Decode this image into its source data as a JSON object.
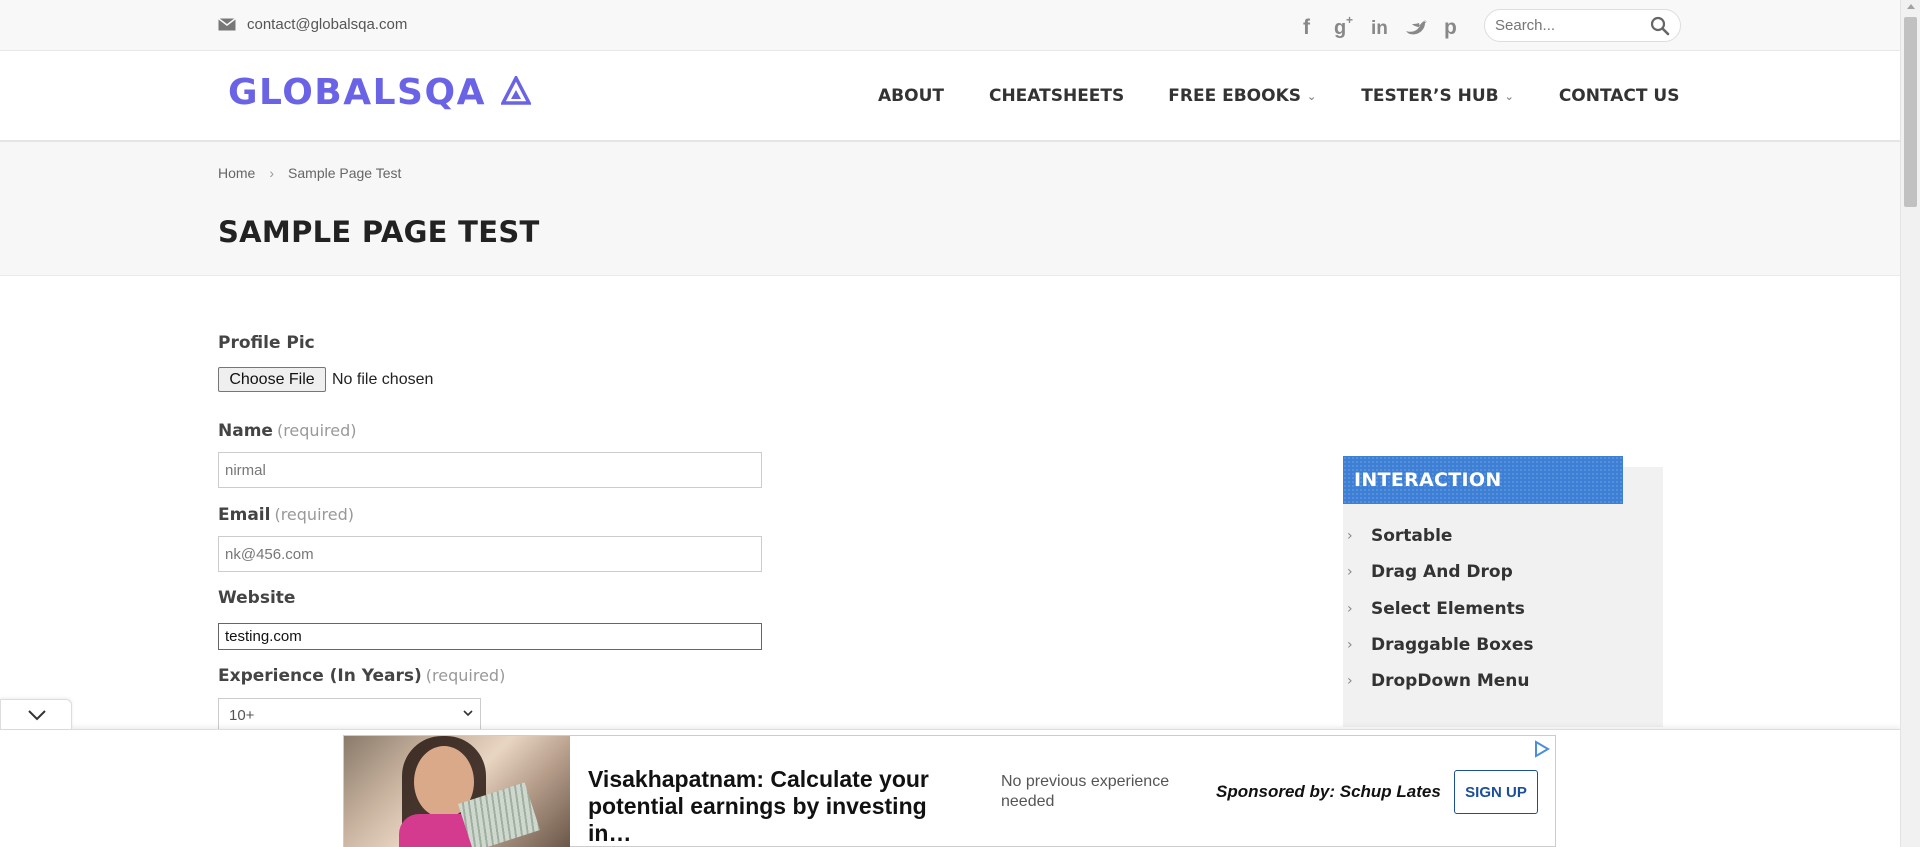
{
  "topbar": {
    "email": "contact@globalsqa.com",
    "social": [
      "facebook-icon",
      "google-plus-icon",
      "linkedin-icon",
      "twitter-icon",
      "pinterest-icon"
    ],
    "search_placeholder": "Search..."
  },
  "header": {
    "logo": "GLOBALSQA",
    "nav": [
      {
        "label": "ABOUT",
        "dropdown": false
      },
      {
        "label": "CHEATSHEETS",
        "dropdown": false
      },
      {
        "label": "FREE EBOOKS",
        "dropdown": true
      },
      {
        "label": "TESTER’S HUB",
        "dropdown": true
      },
      {
        "label": "CONTACT US",
        "dropdown": false
      }
    ]
  },
  "breadcrumb": {
    "home": "Home",
    "separator": "›",
    "current": "Sample Page Test"
  },
  "page_title": "SAMPLE PAGE TEST",
  "form": {
    "profile_pic": {
      "label": "Profile Pic",
      "button": "Choose File",
      "status": "No file chosen"
    },
    "name": {
      "label": "Name",
      "required": "(required)",
      "value": "nirmal"
    },
    "email": {
      "label": "Email",
      "required": "(required)",
      "value": "nk@456.com"
    },
    "website": {
      "label": "Website",
      "value": "testing.com"
    },
    "experience": {
      "label": "Experience (In Years)",
      "required": "(required)",
      "selected": "10+"
    }
  },
  "sidebar": {
    "title": "INTERACTION",
    "items": [
      "Sortable",
      "Drag And Drop",
      "Select Elements",
      "Draggable Boxes",
      "DropDown Menu"
    ]
  },
  "ad": {
    "title": "Visakhapatnam: Calculate your potential earnings by investing in…",
    "subtitle": "No previous experience needed",
    "sponsor": "Sponsored by: Schup Lates",
    "button": "SIGN UP"
  },
  "colors": {
    "brand": "#6b63e6",
    "widget_header": "#3d7fd4",
    "ad_button": "#1b4f9c"
  }
}
